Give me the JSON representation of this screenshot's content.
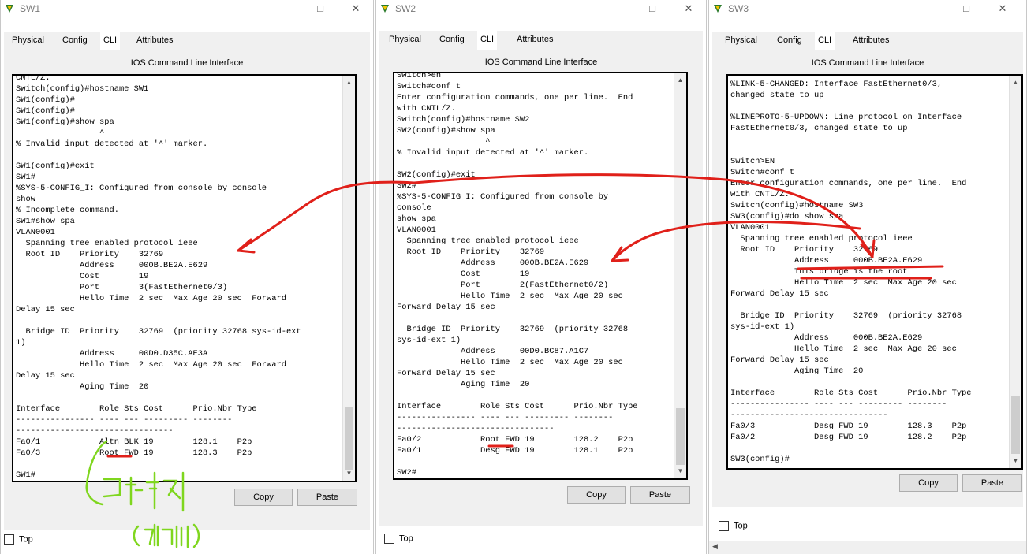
{
  "windows": [
    {
      "id": "sw1",
      "title": "SW1",
      "tabs": [
        "Physical",
        "Config",
        "CLI",
        "Attributes"
      ],
      "active_tab": "CLI",
      "panel_title": "IOS Command Line Interface",
      "terminal_lines": [
        "CNTL/Z.",
        "Switch(config)#hostname SW1",
        "SW1(config)#",
        "SW1(config)#",
        "SW1(config)#show spa",
        "                 ^",
        "% Invalid input detected at '^' marker.",
        "",
        "SW1(config)#exit",
        "SW1#",
        "%SYS-5-CONFIG_I: Configured from console by console",
        "show",
        "% Incomplete command.",
        "SW1#show spa",
        "VLAN0001",
        "  Spanning tree enabled protocol ieee",
        "  Root ID    Priority    32769",
        "             Address     000B.BE2A.E629",
        "             Cost        19",
        "             Port        3(FastEthernet0/3)",
        "             Hello Time  2 sec  Max Age 20 sec  Forward",
        "Delay 15 sec",
        "",
        "  Bridge ID  Priority    32769  (priority 32768 sys-id-ext",
        "1)",
        "             Address     00D0.D35C.AE3A",
        "             Hello Time  2 sec  Max Age 20 sec  Forward",
        "Delay 15 sec",
        "             Aging Time  20",
        "",
        "Interface        Role Sts Cost      Prio.Nbr Type",
        "---------------- ---- --- --------- --------",
        "--------------------------------",
        "Fa0/1            Altn BLK 19        128.1    P2p",
        "Fa0/3            Root FWD 19        128.3    P2p",
        "",
        "SW1#"
      ],
      "copy_label": "Copy",
      "paste_label": "Paste",
      "top_label": "Top"
    },
    {
      "id": "sw2",
      "title": "SW2",
      "tabs": [
        "Physical",
        "Config",
        "CLI",
        "Attributes"
      ],
      "active_tab": "CLI",
      "panel_title": "IOS Command Line Interface",
      "terminal_lines": [
        "Switch>en",
        "Switch#conf t",
        "Enter configuration commands, one per line.  End",
        "with CNTL/Z.",
        "Switch(config)#hostname SW2",
        "SW2(config)#show spa",
        "                  ^",
        "% Invalid input detected at '^' marker.",
        "",
        "SW2(config)#exit",
        "SW2#",
        "%SYS-5-CONFIG_I: Configured from console by",
        "console",
        "show spa",
        "VLAN0001",
        "  Spanning tree enabled protocol ieee",
        "  Root ID    Priority    32769",
        "             Address     000B.BE2A.E629",
        "             Cost        19",
        "             Port        2(FastEthernet0/2)",
        "             Hello Time  2 sec  Max Age 20 sec",
        "Forward Delay 15 sec",
        "",
        "  Bridge ID  Priority    32769  (priority 32768",
        "sys-id-ext 1)",
        "             Address     00D0.BC87.A1C7",
        "             Hello Time  2 sec  Max Age 20 sec",
        "Forward Delay 15 sec",
        "             Aging Time  20",
        "",
        "Interface        Role Sts Cost      Prio.Nbr Type",
        "---------------- ---- --- --------- --------",
        "--------------------------------",
        "Fa0/2            Root FWD 19        128.2    P2p",
        "Fa0/1            Desg FWD 19        128.1    P2p",
        "",
        "SW2#"
      ],
      "copy_label": "Copy",
      "paste_label": "Paste",
      "top_label": "Top"
    },
    {
      "id": "sw3",
      "title": "SW3",
      "tabs": [
        "Physical",
        "Config",
        "CLI",
        "Attributes"
      ],
      "active_tab": "CLI",
      "panel_title": "IOS Command Line Interface",
      "terminal_lines": [
        "%LINK-5-CHANGED: Interface FastEthernet0/3,",
        "changed state to up",
        "",
        "%LINEPROTO-5-UPDOWN: Line protocol on Interface",
        "FastEthernet0/3, changed state to up",
        "",
        "",
        "Switch>EN",
        "Switch#conf t",
        "Enter configuration commands, one per line.  End",
        "with CNTL/Z.",
        "Switch(config)#hostname SW3",
        "SW3(config)#do show spa",
        "VLAN0001",
        "  Spanning tree enabled protocol ieee",
        "  Root ID    Priority    32769",
        "             Address     000B.BE2A.E629",
        "             This bridge is the root",
        "             Hello Time  2 sec  Max Age 20 sec",
        "Forward Delay 15 sec",
        "",
        "  Bridge ID  Priority    32769  (priority 32768",
        "sys-id-ext 1)",
        "             Address     000B.BE2A.E629",
        "             Hello Time  2 sec  Max Age 20 sec",
        "Forward Delay 15 sec",
        "             Aging Time  20",
        "",
        "Interface        Role Sts Cost      Prio.Nbr Type",
        "---------------- ---- --- --------- --------",
        "--------------------------------",
        "Fa0/3            Desg FWD 19        128.3    P2p",
        "Fa0/2            Desg FWD 19        128.2    P2p",
        "",
        "SW3(config)#"
      ],
      "copy_label": "Copy",
      "paste_label": "Paste",
      "top_label": "Top"
    }
  ],
  "annotations": {
    "handwritten_note_main": "대체",
    "handwritten_note_sub": "(예비)",
    "red_color": "#e0201a",
    "green_color": "#7fd61e"
  }
}
